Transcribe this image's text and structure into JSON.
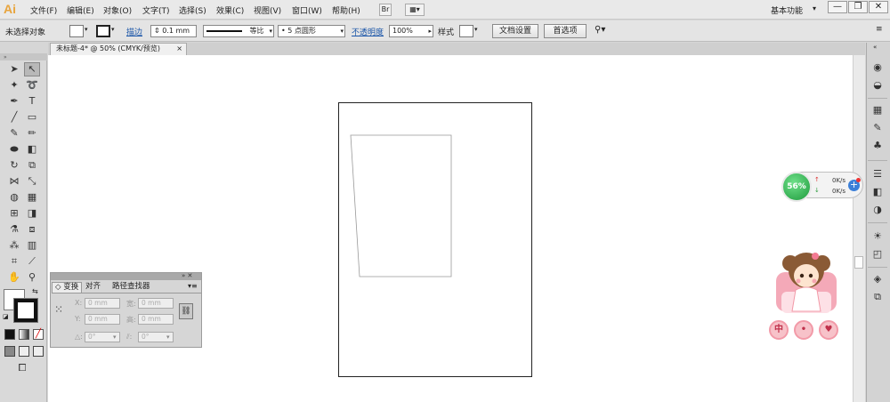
{
  "app": {
    "logo": "Ai"
  },
  "menu": [
    {
      "label": "文件(F)"
    },
    {
      "label": "编辑(E)"
    },
    {
      "label": "对象(O)"
    },
    {
      "label": "文字(T)"
    },
    {
      "label": "选择(S)"
    },
    {
      "label": "效果(C)"
    },
    {
      "label": "视图(V)"
    },
    {
      "label": "窗口(W)"
    },
    {
      "label": "帮助(H)"
    }
  ],
  "menubar_bridge": "Br",
  "workspace": "基本功能",
  "window_buttons": {
    "minimize": "—",
    "restore": "❐",
    "close": "✕"
  },
  "control": {
    "selection": "未选择对象",
    "stroke_label": "描边",
    "stroke_value": "0.1 mm",
    "profile": "等比",
    "brush": "5 点圆形",
    "opacity_label": "不透明度",
    "opacity_value": "100%",
    "style_label": "样式",
    "doc_setup": "文档设置",
    "preferences": "首选项"
  },
  "document_tab": {
    "title": "未标题-4* @ 50% (CMYK/预览)",
    "close": "×"
  },
  "transform_panel": {
    "tabs": [
      "◇ 变换",
      "对齐",
      "路径查找器"
    ],
    "x_label": "X:",
    "x_value": "0 mm",
    "y_label": "Y:",
    "y_value": "0 mm",
    "w_label": "宽:",
    "w_value": "0 mm",
    "h_label": "高:",
    "h_value": "0 mm",
    "rot_label": "△:",
    "rot_value": "0°",
    "shear_label": "⫽:",
    "shear_value": "0°",
    "close": "»  ✕",
    "menu": "▾≡"
  },
  "speed_widget": {
    "percent": "56%",
    "up": "0K/s",
    "down": "0K/s",
    "plus": "+"
  },
  "sticker": {
    "buttons": [
      "中",
      "•",
      "♥"
    ]
  },
  "colors": {
    "canvas": "#ffffff",
    "ui_bg": "#d6d6d6",
    "logo": "#e8a43c",
    "link": "#1a55a8",
    "speed_green": "#1e9a3c"
  }
}
